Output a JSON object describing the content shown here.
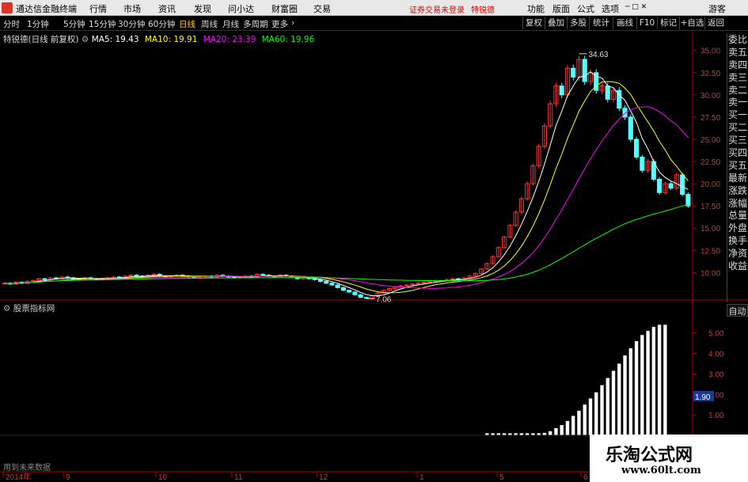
{
  "app": {
    "title": "通达信金融终端",
    "menus": [
      "行情",
      "市场",
      "资讯",
      "发现",
      "问小达",
      "财富圈",
      "交易"
    ],
    "warning": "证券交易未登录",
    "stock_name_top": "特锐德",
    "right_menus": [
      "功能",
      "版面",
      "公式",
      "选项"
    ],
    "guest": "游客"
  },
  "toolbar": {
    "periods": [
      "分时",
      "1分钟",
      "5分钟",
      "15分钟",
      "30分钟",
      "60分钟",
      "日线",
      "周线",
      "月线",
      "多周期",
      "更多"
    ],
    "active_period": "日线",
    "right_buttons": [
      "复权",
      "叠加",
      "多股",
      "统计",
      "画线",
      "F10",
      "标记",
      "+自选",
      "返回"
    ]
  },
  "main_header": {
    "stock": "特锐德(日线 前复权)",
    "ma5": "MA5: 19.43",
    "ma10": "MA10: 19.91",
    "ma20": "MA20: 23.39",
    "ma60": "MA60: 19.96"
  },
  "sub_header": "股票指标网",
  "future_label": "用到未来数据",
  "auto_button": "自动",
  "side_panel": [
    "委比",
    "卖五",
    "卖四",
    "卖三",
    "卖二",
    "卖一",
    "买一",
    "买二",
    "买三",
    "买四",
    "买五",
    "最新",
    "涨跌",
    "涨幅",
    "总量",
    "外盘",
    "换手",
    "净资",
    "收益"
  ],
  "watermark": {
    "line1": "乐淘公式网",
    "line2": "www.60lt.com"
  },
  "colors": {
    "up": "#ff3232",
    "down": "#54ffff",
    "ma5": "#ffffff",
    "ma10": "#ffff00",
    "ma20": "#ff00ff",
    "ma60": "#00ff00",
    "axis": "#b00000"
  },
  "chart_data": [
    {
      "type": "candlestick",
      "title": "特锐德(日线 前复权)",
      "y_ticks": [
        10.0,
        12.5,
        15.0,
        17.5,
        20.0,
        22.5,
        25.0,
        27.5,
        30.0,
        32.5,
        35.0
      ],
      "ylim": [
        7.0,
        35.6
      ],
      "annotations": [
        {
          "label": "34.63",
          "value": 34.63
        },
        {
          "label": "7.06",
          "value": 7.06
        }
      ],
      "x_ticks": [
        "2014年",
        "9",
        "10",
        "11",
        "12",
        "1",
        "5",
        "6"
      ],
      "close": [
        8.8,
        8.7,
        8.9,
        8.8,
        9.0,
        9.1,
        9.3,
        9.2,
        9.4,
        9.3,
        9.5,
        9.4,
        9.3,
        9.2,
        9.4,
        9.3,
        9.2,
        9.3,
        9.4,
        9.5,
        9.4,
        9.6,
        9.7,
        9.6,
        9.5,
        9.7,
        9.8,
        9.6,
        9.5,
        9.6,
        9.7,
        9.6,
        9.5,
        9.4,
        9.5,
        9.6,
        9.5,
        9.7,
        9.6,
        9.5,
        9.4,
        9.5,
        9.6,
        9.5,
        9.8,
        9.7,
        9.6,
        9.5,
        9.7,
        9.6,
        9.5,
        9.3,
        9.4,
        9.3,
        9.2,
        9.0,
        8.8,
        8.6,
        8.3,
        8.0,
        7.8,
        7.5,
        7.2,
        7.1,
        7.4,
        7.7,
        8.0,
        8.2,
        8.4,
        8.5,
        8.6,
        8.7,
        8.8,
        8.9,
        9.0,
        9.1,
        9.1,
        9.2,
        9.3,
        9.2,
        9.4,
        9.6,
        9.9,
        10.4,
        11.0,
        11.8,
        12.8,
        14.0,
        15.3,
        16.8,
        18.3,
        20.0,
        22.0,
        24.2,
        26.5,
        29.0,
        31.0,
        30.0,
        33.0,
        32.0,
        34.0,
        31.5,
        32.5,
        30.5,
        31.0,
        29.5,
        30.5,
        28.5,
        27.5,
        25.0,
        23.0,
        21.5,
        22.5,
        20.5,
        19.0,
        20.0,
        19.5,
        21.0,
        18.8,
        17.5
      ],
      "ma_lines": [
        "MA5",
        "MA10",
        "MA20",
        "MA60"
      ]
    },
    {
      "type": "bar",
      "title": "股票指标网",
      "y_ticks": [
        1.0,
        2.0,
        3.0,
        4.0,
        5.0
      ],
      "ylim": [
        0,
        5.8
      ],
      "current_label": "1.90",
      "values": [
        0.1,
        0.1,
        0.1,
        0.1,
        0.1,
        0.1,
        0.1,
        0.1,
        0.1,
        0.1,
        0.12,
        0.2,
        0.35,
        0.5,
        0.7,
        0.95,
        1.2,
        1.5,
        1.8,
        2.1,
        2.45,
        2.8,
        3.15,
        3.5,
        3.9,
        4.25,
        4.6,
        4.9,
        5.1,
        5.3,
        5.4,
        5.4
      ],
      "start_index": 84
    }
  ]
}
